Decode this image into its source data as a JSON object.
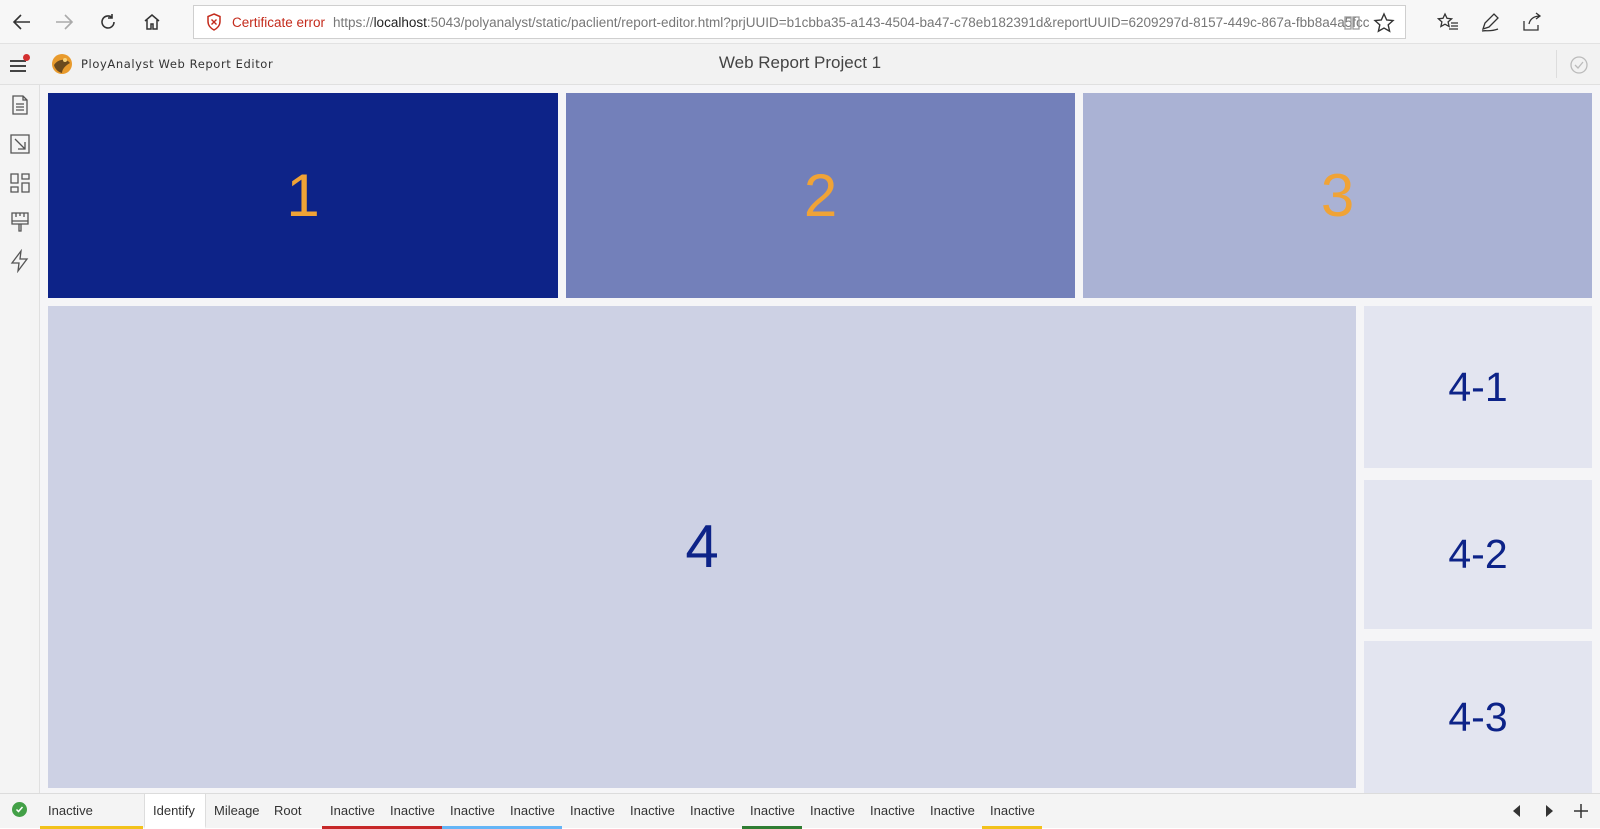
{
  "browser": {
    "cert_label": "Certificate error",
    "url_prefix": "https://",
    "url_host": "localhost",
    "url_rest": ":5043/polyanalyst/static/paclient/report-editor.html?prjUUID=b1cbba35-a143-4504-ba47-c78eb182391d&reportUUID=6209297d-8157-449c-867a-fbb8a4a5fcc"
  },
  "app": {
    "name": "PloyAnalyst Web Report Editor",
    "report_title": "Web Report Project 1"
  },
  "tiles": {
    "t1": "1",
    "t2": "2",
    "t3": "3",
    "t4": "4",
    "t4_1": "4-1",
    "t4_2": "4-2",
    "t4_3": "4-3"
  },
  "colors": {
    "tile_dark": "#0d2388",
    "tile_mid": "#7380ba",
    "tile_light": "#aab2d4",
    "tile_pale": "#cdd1e4",
    "tile_palest": "#e3e5f0",
    "accent_orange": "#f0a336"
  },
  "tabs": [
    {
      "label": "Inactive",
      "accent": "#f2c21b"
    },
    {
      "label": "Identify",
      "accent": ""
    },
    {
      "label": "Mileage",
      "accent": ""
    },
    {
      "label": "Root",
      "accent": ""
    },
    {
      "label": "Inactive",
      "accent": "#c62828"
    },
    {
      "label": "Inactive",
      "accent": "#c62828"
    },
    {
      "label": "Inactive",
      "accent": "#64b5f6"
    },
    {
      "label": "Inactive",
      "accent": "#64b5f6"
    },
    {
      "label": "Inactive",
      "accent": ""
    },
    {
      "label": "Inactive",
      "accent": ""
    },
    {
      "label": "Inactive",
      "accent": ""
    },
    {
      "label": "Inactive",
      "accent": "#2e7d32"
    },
    {
      "label": "Inactive",
      "accent": ""
    },
    {
      "label": "Inactive",
      "accent": ""
    },
    {
      "label": "Inactive",
      "accent": ""
    },
    {
      "label": "Inactive",
      "accent": "#f2c21b"
    }
  ],
  "active_tab": "Identify"
}
